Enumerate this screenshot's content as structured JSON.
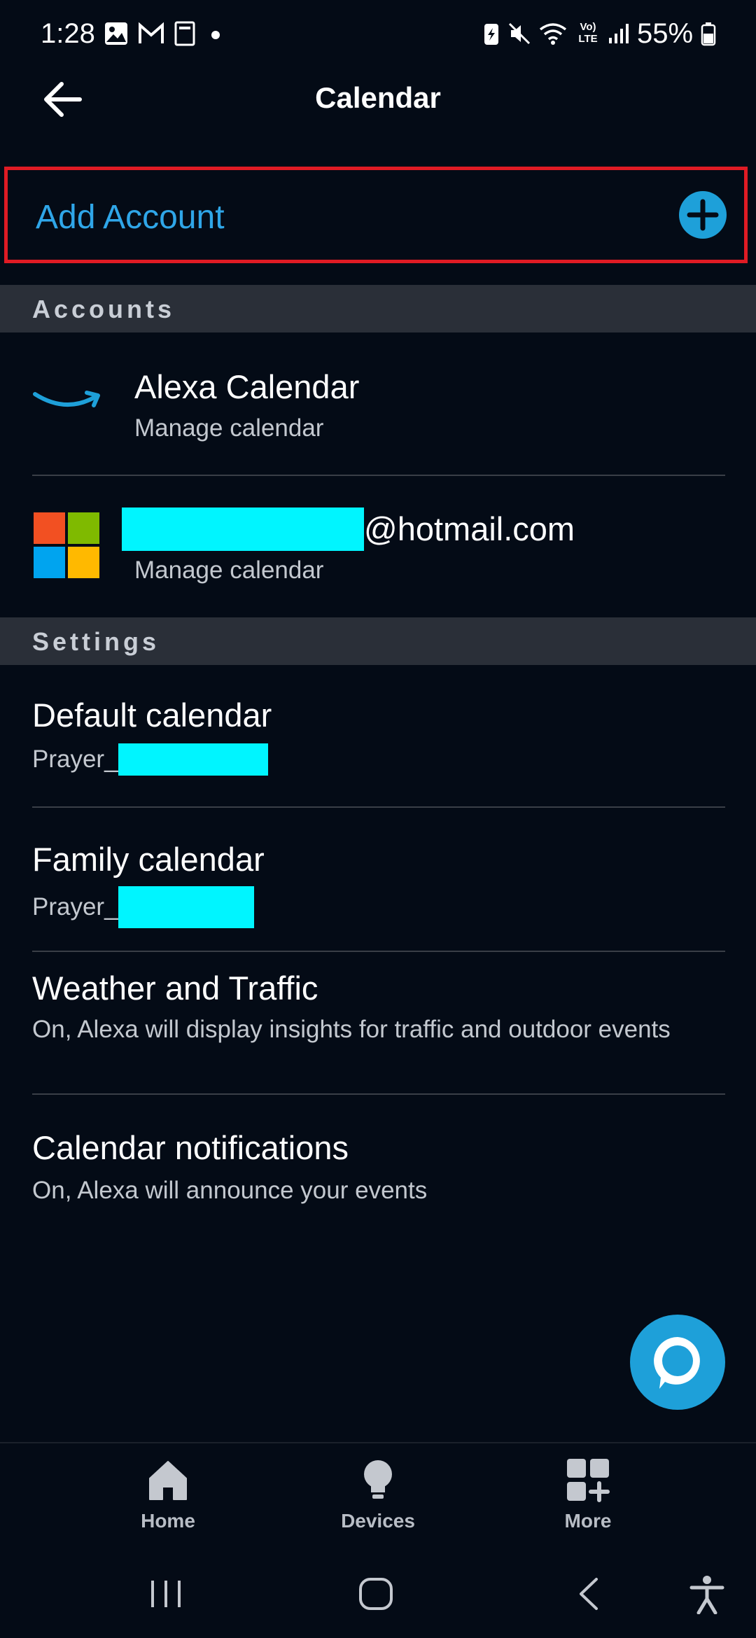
{
  "status_bar": {
    "time": "1:28",
    "battery": "55%",
    "left_icons": [
      "image-icon",
      "gmail-icon",
      "sim-card-icon",
      "dot-icon"
    ],
    "right_icons": [
      "battery-saver-icon",
      "mute-icon",
      "wifi-icon",
      "volte-icon",
      "signal-icon",
      "battery-icon"
    ],
    "volte_label_top": "Vo)",
    "volte_label_bottom": "LTE"
  },
  "header": {
    "title": "Calendar",
    "back_icon": "arrow-left-icon"
  },
  "add_account": {
    "label": "Add Account",
    "icon": "plus-circle-icon",
    "highlight_color": "#e01b24",
    "accent_color": "#2fa6e8"
  },
  "accounts": {
    "section_title": "Accounts",
    "items": [
      {
        "name": "Alexa Calendar",
        "subtitle": "Manage calendar",
        "icon": "amazon-smile-icon"
      },
      {
        "name_suffix": "@hotmail.com",
        "subtitle": "Manage calendar",
        "icon": "microsoft-logo-icon",
        "redacted": true
      }
    ]
  },
  "settings": {
    "section_title": "Settings",
    "items": [
      {
        "title": "Default calendar",
        "value_prefix": "Prayer_",
        "redacted": true
      },
      {
        "title": "Family calendar",
        "value_prefix": "Prayer_",
        "redacted": true
      },
      {
        "title": "Weather and Traffic",
        "value": "On, Alexa will display insights for traffic and outdoor events"
      },
      {
        "title": "Calendar notifications",
        "value": "On, Alexa will announce your events"
      }
    ]
  },
  "fab": {
    "icon": "alexa-ring-icon",
    "color": "#1ea0d9"
  },
  "bottom_nav": [
    {
      "label": "Home",
      "icon": "home-icon"
    },
    {
      "label": "Devices",
      "icon": "lightbulb-icon"
    },
    {
      "label": "More",
      "icon": "grid-plus-icon"
    }
  ],
  "system_nav": [
    "recents-icon",
    "home-circle-icon",
    "back-chevron-icon",
    "accessibility-icon"
  ],
  "colors": {
    "background": "#040b16",
    "section_bg": "#2a2f38",
    "redaction": "#00f5ff"
  }
}
